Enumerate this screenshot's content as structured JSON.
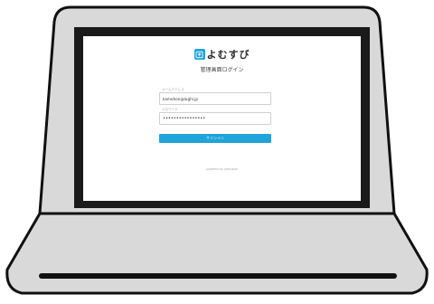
{
  "app": {
    "logo_text": "よむすび",
    "page_title": "管理画面ログイン"
  },
  "form": {
    "email_label": "メールアドレス",
    "email_value": "kamehon@lughi.jp",
    "password_label": "パスワード",
    "password_value": "••••••••••••••••",
    "signin_label": "サインイン"
  },
  "footer": {
    "powered_by": "powered by yomusubi"
  },
  "icons": {
    "logo": "app-logo-icon"
  },
  "colors": {
    "accent": "#1fa3d8",
    "laptop_body": "#d9d9d9",
    "outline": "#111111",
    "screen_bezel": "#1a1a1a"
  }
}
